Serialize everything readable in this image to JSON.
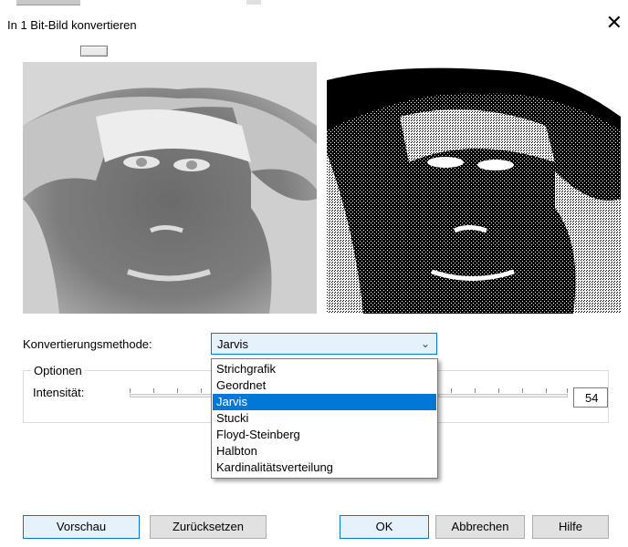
{
  "window": {
    "title": "In 1 Bit-Bild konvertieren",
    "close_glyph": "✕"
  },
  "method": {
    "label": "Konvertierungsmethode:",
    "selected": "Jarvis",
    "options": [
      "Strichgrafik",
      "Geordnet",
      "Jarvis",
      "Stucki",
      "Floyd-Steinberg",
      "Halbton",
      "Kardinalitätsverteilung"
    ]
  },
  "options_group": {
    "legend": "Optionen",
    "intensity_label": "Intensität:",
    "intensity_value": "54"
  },
  "buttons": {
    "preview": "Vorschau",
    "reset": "Zurücksetzen",
    "ok": "OK",
    "cancel": "Abbrechen",
    "help": "Hilfe"
  },
  "icons": {
    "combo_chevron": "chevron-down-icon",
    "close": "close-icon"
  },
  "colors": {
    "accent": "#0078d7",
    "selection_bg": "#0078d7",
    "button_face": "#e1e1e1",
    "primary_face": "#e5f1fb"
  }
}
